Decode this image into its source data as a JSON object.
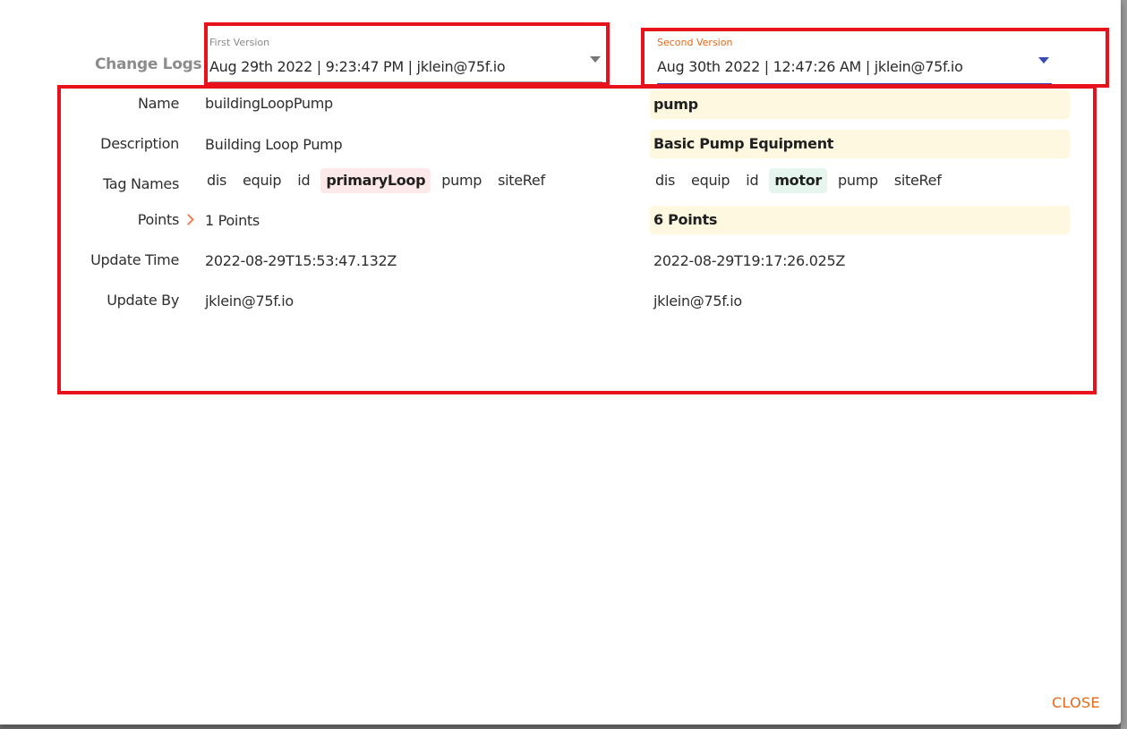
{
  "header": {
    "title": "Change Logs"
  },
  "first_version": {
    "caption": "First Version",
    "value": "Aug 29th 2022 | 9:23:47 PM | jklein@75f.io"
  },
  "second_version": {
    "caption": "Second Version",
    "value": "Aug 30th 2022 | 12:47:26 AM | jklein@75f.io"
  },
  "rows": {
    "name": {
      "label": "Name",
      "first": "buildingLoopPump",
      "second": "pump"
    },
    "description": {
      "label": "Description",
      "first": "Building Loop Pump",
      "second": "Basic Pump Equipment"
    },
    "tag_names": {
      "label": "Tag Names",
      "first": [
        "dis",
        "equip",
        "id",
        "primaryLoop",
        "pump",
        "siteRef"
      ],
      "second": [
        "dis",
        "equip",
        "id",
        "motor",
        "pump",
        "siteRef"
      ]
    },
    "points": {
      "label": "Points",
      "first": "1 Points",
      "second": "6 Points"
    },
    "update_time": {
      "label": "Update Time",
      "first": "2022-08-29T15:53:47.132Z",
      "second": "2022-08-29T19:17:26.025Z"
    },
    "update_by": {
      "label": "Update By",
      "first": "jklein@75f.io",
      "second": "jklein@75f.io"
    }
  },
  "footer": {
    "close_label": "CLOSE"
  },
  "colors": {
    "highlight_box": "#e8121c",
    "accent": "#e26a1b",
    "changed_bg": "#fdf8df",
    "removed_tag_bg": "#fde9e9",
    "added_tag_bg": "#e6f5ee",
    "select_active": "#3a4cb0"
  }
}
